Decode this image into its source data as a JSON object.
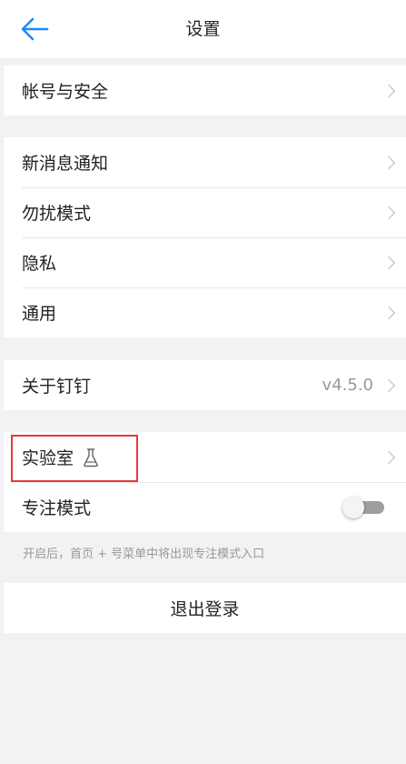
{
  "header": {
    "title": "设置",
    "back_icon": "arrow-left-icon"
  },
  "groups": {
    "account": {
      "items": [
        {
          "label": "帐号与安全"
        }
      ]
    },
    "general": {
      "items": [
        {
          "label": "新消息通知"
        },
        {
          "label": "勿扰模式"
        },
        {
          "label": "隐私"
        },
        {
          "label": "通用"
        }
      ]
    },
    "about": {
      "label": "关于钉钉",
      "version": "v4.5.0"
    },
    "lab": {
      "label": "实验室",
      "icon": "flask-icon"
    },
    "focus": {
      "label": "专注模式",
      "enabled": false
    },
    "focus_hint": "开启后，首页 + 号菜单中将出现专注模式入口"
  },
  "logout_label": "退出登录",
  "colors": {
    "accent": "#1a8cff",
    "highlight": "#e53935",
    "toggle_off": "#9e9e9e"
  }
}
